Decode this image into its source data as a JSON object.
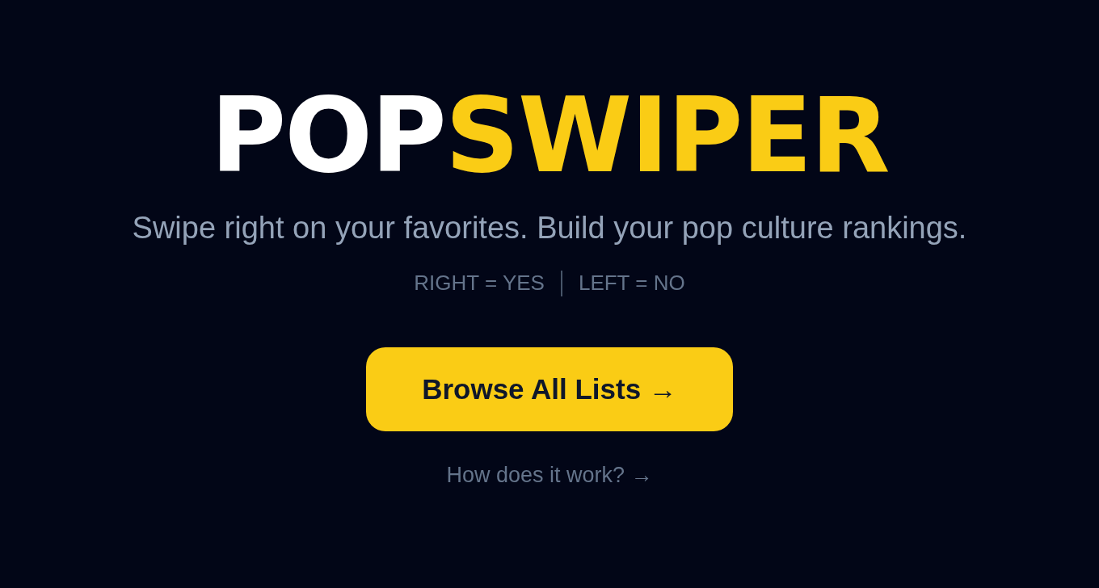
{
  "logo": {
    "parts": [
      {
        "text": "POP",
        "kind": "plain"
      },
      {
        "text": "SWIPER",
        "kind": "accent"
      }
    ]
  },
  "tagline": "Swipe right on your favorites. Build your pop culture rankings.",
  "hints": [
    "RIGHT = YES",
    "LEFT = NO"
  ],
  "primary_button": "Browse All Lists →",
  "help_link": "How does it work? →"
}
